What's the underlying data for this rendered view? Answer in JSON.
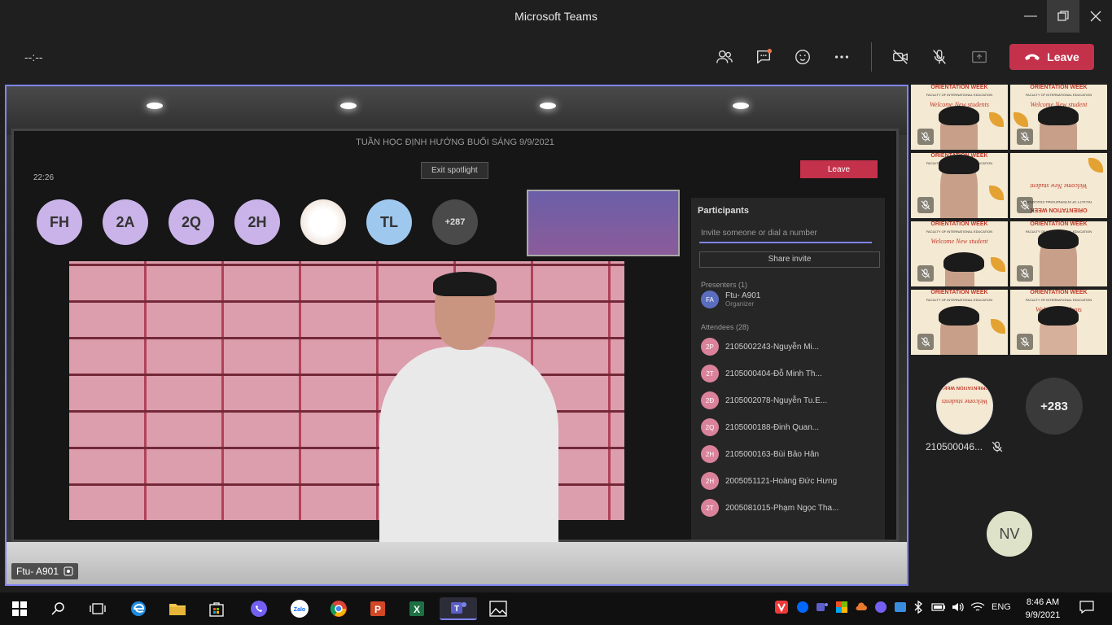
{
  "window": {
    "title": "Microsoft Teams"
  },
  "toolbar": {
    "timer": "--:--",
    "leave_label": "Leave"
  },
  "main_video": {
    "presenter_name": "Ftu- A901",
    "inner_title": "TUẦN HỌC ĐỊNH HƯỚNG BUỔI SÁNG 9/9/2021",
    "inner_time": "22:26",
    "exit_spotlight": "Exit spotlight",
    "inner_leave": "Leave",
    "avatars": [
      "FH",
      "2A",
      "2Q",
      "2H",
      "",
      "TL",
      "+287"
    ],
    "participants_title": "Participants",
    "invite_placeholder": "Invite someone or dial a number",
    "share_invite": "Share invite",
    "presenters_label": "Presenters (1)",
    "presenter_row": "Ftu- A901",
    "presenter_role": "Organizer",
    "attendees_label": "Attendees (28)",
    "attendees": [
      {
        "initials": "2P",
        "name": "2105002243-Nguyễn Mi..."
      },
      {
        "initials": "2T",
        "name": "2105000404-Đỗ Minh Th..."
      },
      {
        "initials": "2Đ",
        "name": "2105002078-Nguyễn Tu.E..."
      },
      {
        "initials": "2Q",
        "name": "2105000188-Đinh Quan..."
      },
      {
        "initials": "2H",
        "name": "2105000163-Bùi Bảo Hân"
      },
      {
        "initials": "2H",
        "name": "2005051121-Hoàng Đức Hưng"
      },
      {
        "initials": "2T",
        "name": "2005081015-Phạm Ngọc Tha..."
      }
    ]
  },
  "tiles": [
    {
      "header": "ORIENTATION WEEK",
      "sub": "FACULTY OF INTERNATIONAL EDUCATION",
      "welcome": "Welcome New students"
    },
    {
      "header": "ORIENTATION WEEK",
      "sub": "FACULTY OF INTERNATIONAL EDUCATION",
      "welcome": "Welcome New student"
    },
    {
      "header": "ORIENTATION WEEK",
      "sub": "FACULTY OF INTERNATIONAL EDUCATION",
      "welcome": ""
    },
    {
      "header": "ORIENTATION WEEK",
      "sub": "FACULTY OF INTERNATIONAL EDUCATION",
      "welcome": "Welcome New student"
    },
    {
      "header": "ORIENTATION WEEK",
      "sub": "FACULTY OF INTERNATIONAL EDUCATION",
      "welcome": "Welcome New student"
    },
    {
      "header": "ORIENTATION WEEK",
      "sub": "FACULTY OF INTERNATIONAL EDUCATION",
      "welcome": ""
    },
    {
      "header": "ORIENTATION WEEK",
      "sub": "FACULTY OF INTERNATIONAL EDUCATION",
      "welcome": ""
    },
    {
      "header": "ORIENTATION WEEK",
      "sub": "FACULTY OF INTERNATIONAL EDUCATION",
      "welcome": "Welcome students"
    }
  ],
  "big_avatar": {
    "name": "210500046...",
    "header": "ORIENTATION WEEK",
    "welcome": "Welcome students"
  },
  "more_count": "+283",
  "nv_initials": "NV",
  "taskbar": {
    "lang": "ENG",
    "time": "8:46 AM",
    "date": "9/9/2021"
  },
  "colors": {
    "accent": "#7f85f5",
    "leave": "#c4314b",
    "background": "#1f1f1f"
  }
}
